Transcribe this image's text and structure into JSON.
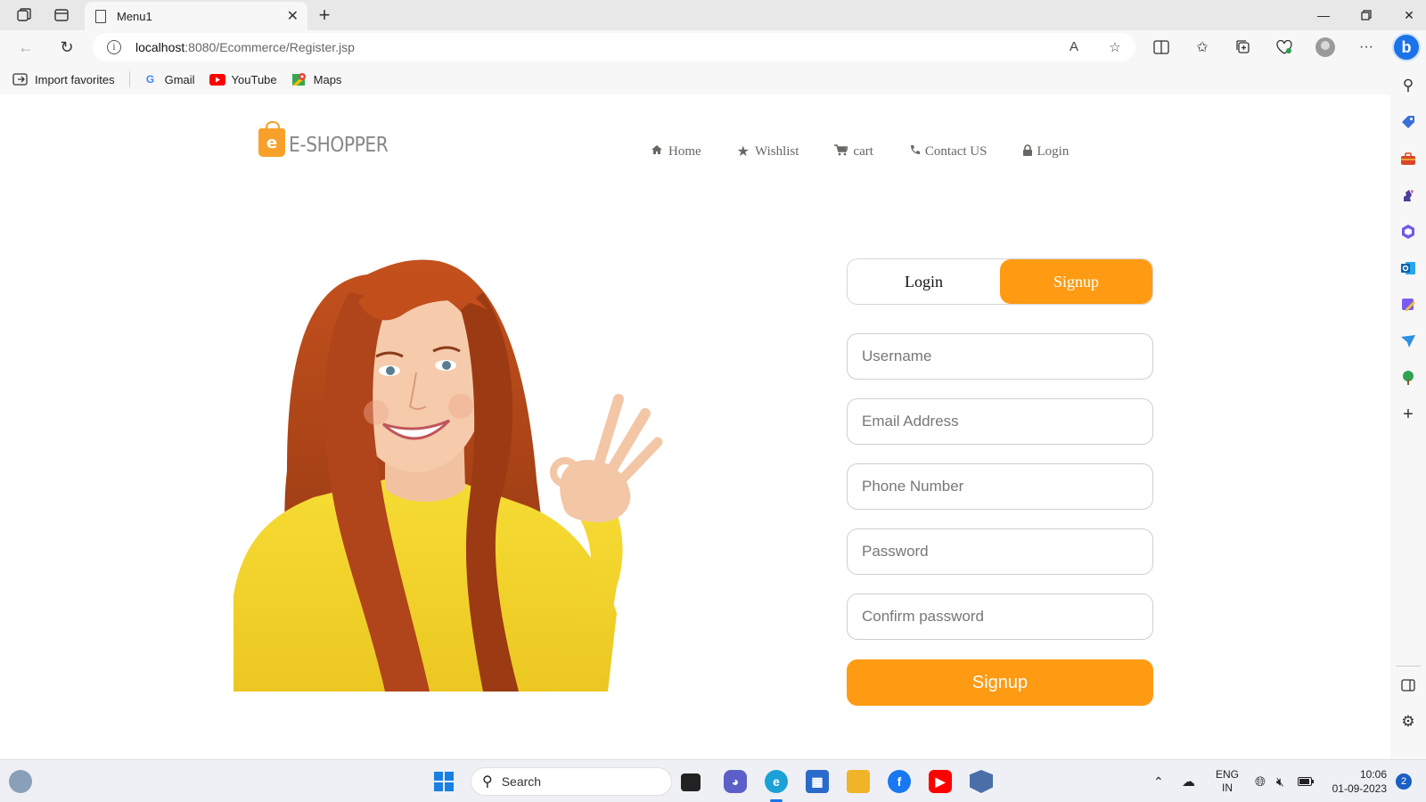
{
  "browser": {
    "tab_title": "Menu1",
    "url_host": "localhost",
    "url_path": ":8080/Ecommerce/Register.jsp",
    "bookmarks": [
      {
        "label": "Import favorites",
        "icon": "import-icon"
      },
      {
        "label": "Gmail",
        "icon": "google-icon"
      },
      {
        "label": "YouTube",
        "icon": "youtube-icon"
      },
      {
        "label": "Maps",
        "icon": "maps-icon"
      }
    ]
  },
  "site": {
    "logo_letter": "e",
    "logo_text": "E-SHOPPER",
    "nav": [
      {
        "label": "Home",
        "icon": "home-icon"
      },
      {
        "label": "Wishlist",
        "icon": "star-icon"
      },
      {
        "label": "cart",
        "icon": "cart-icon"
      },
      {
        "label": "Contact US",
        "icon": "phone-icon"
      },
      {
        "label": "Login",
        "icon": "lock-icon"
      }
    ]
  },
  "form": {
    "toggle_login": "Login",
    "toggle_signup": "Signup",
    "username_placeholder": "Username",
    "email_placeholder": "Email Address",
    "phone_placeholder": "Phone Number",
    "password_placeholder": "Password",
    "confirm_placeholder": "Confirm password",
    "submit_label": "Signup"
  },
  "taskbar": {
    "search_label": "Search",
    "lang_line1": "ENG",
    "lang_line2": "IN",
    "time": "10:06",
    "date": "01-09-2023",
    "notification_count": "2"
  },
  "colors": {
    "accent": "#fe9b13",
    "nav_text": "#696763"
  }
}
